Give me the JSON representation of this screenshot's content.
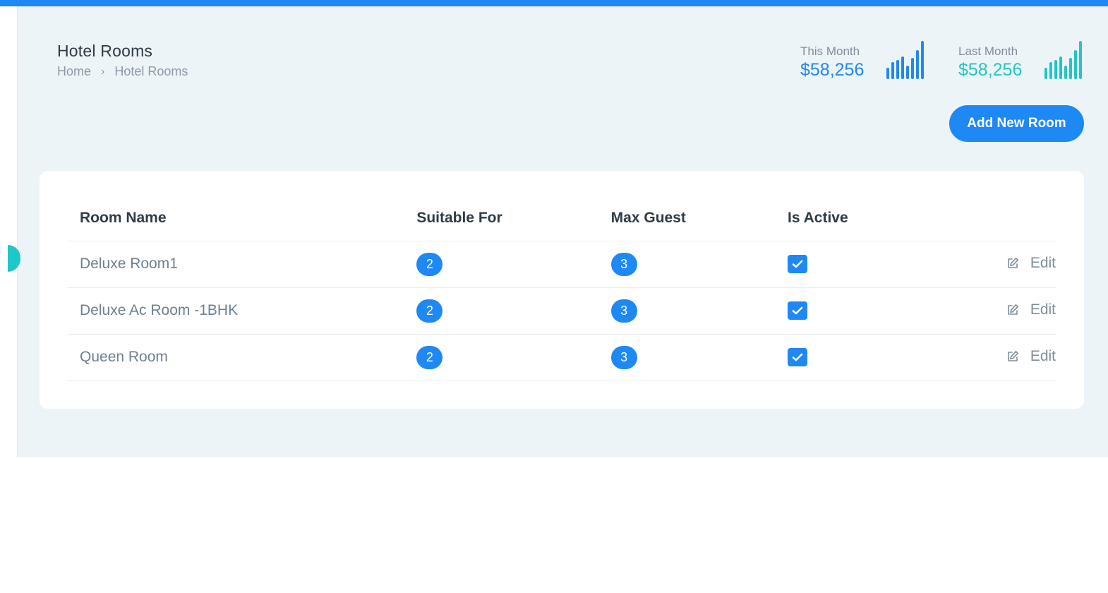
{
  "header": {
    "title": "Hotel Rooms",
    "breadcrumb": {
      "home": "Home",
      "separator": "›",
      "current": "Hotel Rooms"
    }
  },
  "stats": {
    "this_month": {
      "label": "This Month",
      "value": "$58,256",
      "color": "#1e88f5",
      "bars": [
        0.3,
        0.45,
        0.5,
        0.6,
        0.35,
        0.55,
        0.75,
        1.0
      ]
    },
    "last_month": {
      "label": "Last Month",
      "value": "$58,256",
      "color": "#22c6c4",
      "bars": [
        0.3,
        0.45,
        0.5,
        0.6,
        0.35,
        0.55,
        0.75,
        1.0
      ]
    }
  },
  "actions": {
    "add_room": "Add New Room"
  },
  "table": {
    "headers": [
      "Room Name",
      "Suitable For",
      "Max Guest",
      "Is Active",
      ""
    ],
    "rows": [
      {
        "name": "Deluxe Room1",
        "suitable_for": "2",
        "max_guest": "3",
        "is_active": true,
        "edit": "Edit"
      },
      {
        "name": "Deluxe Ac Room -1BHK",
        "suitable_for": "2",
        "max_guest": "3",
        "is_active": true,
        "edit": "Edit"
      },
      {
        "name": "Queen Room",
        "suitable_for": "2",
        "max_guest": "3",
        "is_active": true,
        "edit": "Edit"
      }
    ]
  },
  "colors": {
    "accent": "#1e88f5",
    "accent_secondary": "#22c6c4",
    "background": "#edf4f8",
    "top_bar": "#1e88f5"
  }
}
